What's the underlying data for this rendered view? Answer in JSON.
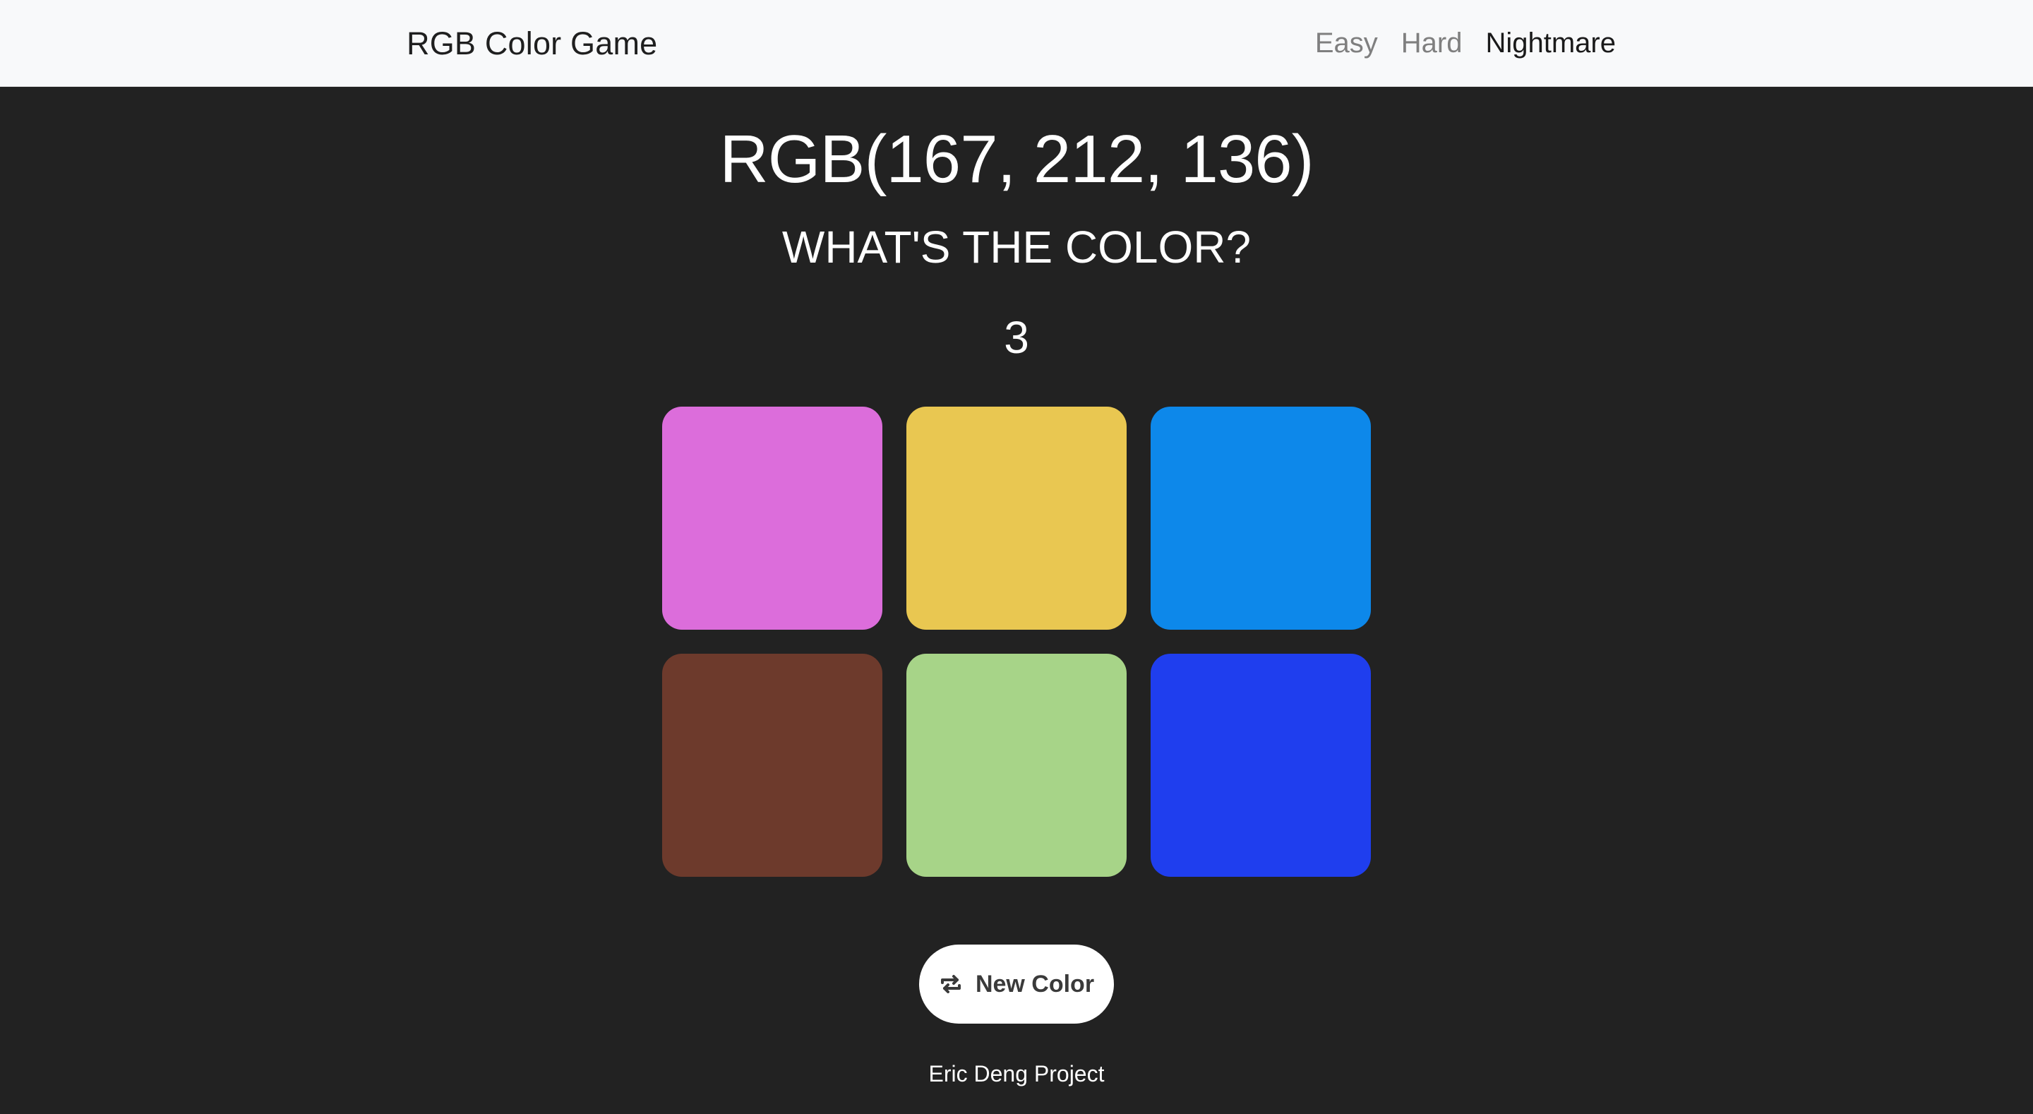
{
  "navbar": {
    "brand": "RGB Color Game",
    "links": [
      {
        "label": "Easy",
        "active": false
      },
      {
        "label": "Hard",
        "active": false
      },
      {
        "label": "Nightmare",
        "active": true
      }
    ]
  },
  "game": {
    "target_rgb": "RGB(167, 212, 136)",
    "prompt": "WHAT'S THE COLOR?",
    "counter": "3",
    "swatches": [
      {
        "color": "#DC6DDB"
      },
      {
        "color": "#E9C751"
      },
      {
        "color": "#0D88EA"
      },
      {
        "color": "#6D3A2C"
      },
      {
        "color": "#A7D488"
      },
      {
        "color": "#1F3EEE"
      }
    ]
  },
  "controls": {
    "new_color_label": "New Color",
    "new_color_icon": "refresh-icon"
  },
  "footer": {
    "text": "Eric Deng Project"
  }
}
